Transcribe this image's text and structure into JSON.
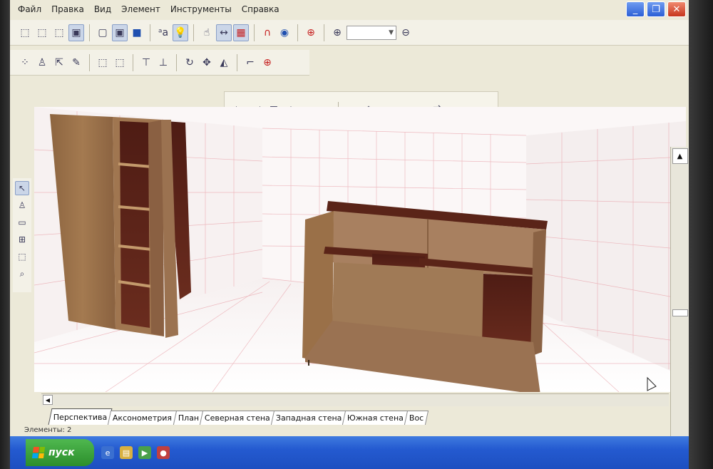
{
  "menu": [
    "Файл",
    "Правка",
    "Вид",
    "Элемент",
    "Инструменты",
    "Справка"
  ],
  "window_buttons": {
    "minimize": "_",
    "maximize": "❐",
    "close": "✕"
  },
  "zoom": {
    "value": ""
  },
  "tabs": [
    "Перспектива",
    "Аксонометрия",
    "План",
    "Северная стена",
    "Западная стена",
    "Южная стена",
    "Вос"
  ],
  "active_tab": "Перспектива",
  "status": "Элементы: 2",
  "taskbar": {
    "start_label": "пуск"
  },
  "colors": {
    "grid": "#e8a0a8",
    "wood_light": "#9a7148",
    "wood_dark": "#5a2418",
    "taskbar": "#245ad0",
    "start": "#3aa63a"
  }
}
